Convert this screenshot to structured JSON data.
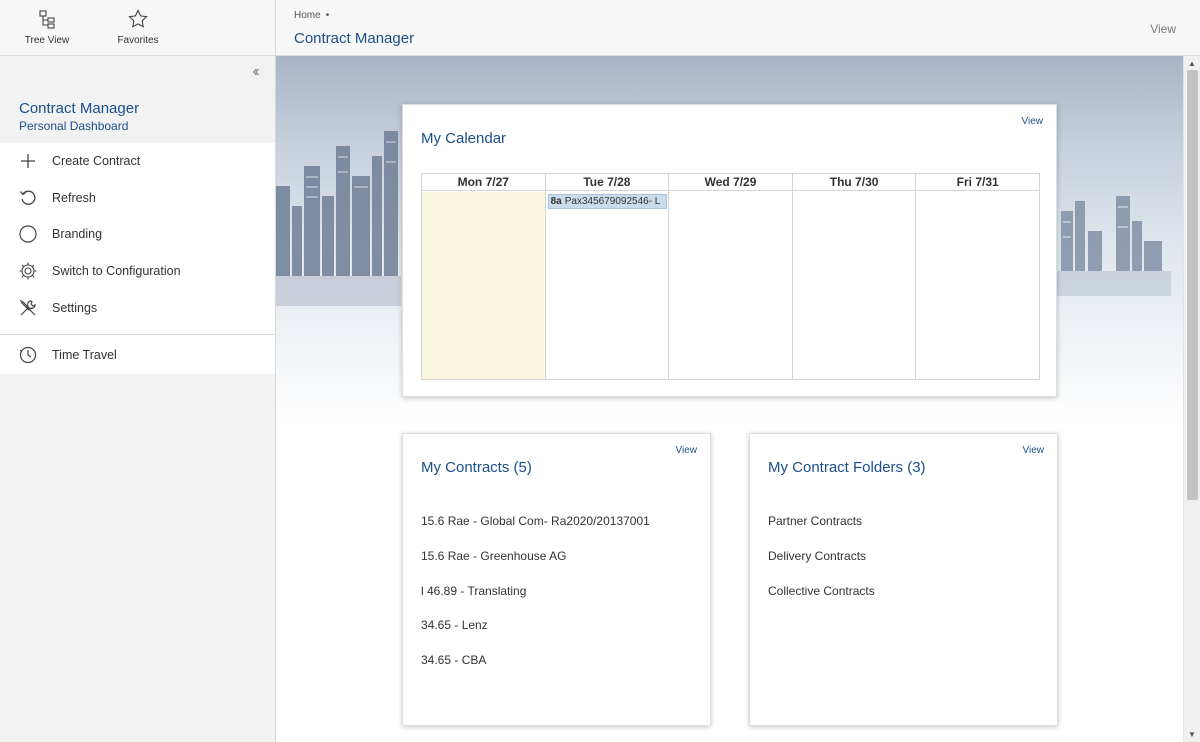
{
  "sidebar": {
    "tabs": [
      {
        "label": "Tree View",
        "icon": "tree-view-icon"
      },
      {
        "label": "Favorites",
        "icon": "star-icon"
      }
    ],
    "collapse_icon": "double-chevron-left-icon",
    "title": "Contract Manager",
    "subtitle": "Personal Dashboard",
    "menu": [
      {
        "label": "Create Contract",
        "icon": "plus-icon"
      },
      {
        "label": "Refresh",
        "icon": "refresh-icon"
      },
      {
        "label": "Branding",
        "icon": "circle-icon"
      },
      {
        "label": "Switch to Configuration",
        "icon": "gear-icon"
      },
      {
        "label": "Settings",
        "icon": "wrench-screwdriver-icon"
      },
      {
        "label": "Time Travel",
        "icon": "clock-icon"
      }
    ]
  },
  "header": {
    "breadcrumb": "Home",
    "breadcrumb_sep": "•",
    "title": "Contract Manager",
    "view_label": "View"
  },
  "calendar": {
    "title": "My Calendar",
    "view_label": "View",
    "days": [
      "Mon 7/27",
      "Tue 7/28",
      "Wed 7/29",
      "Thu 7/30",
      "Fri 7/31"
    ],
    "today_index": 0,
    "event": {
      "time": "8a",
      "text": "Pax345679092546- L",
      "day_index": 1
    }
  },
  "contracts": {
    "title": "My Contracts (5)",
    "view_label": "View",
    "items": [
      "15.6 Rae - Global Com- Ra2020/20137001",
      "15.6 Rae - Greenhouse AG",
      "l 46.89 - Translating",
      "34.65 - Lenz",
      "34.65 - CBA"
    ]
  },
  "folders": {
    "title": "My Contract Folders (3)",
    "view_label": "View",
    "items": [
      "Partner Contracts",
      "Delivery Contracts",
      "Collective Contracts"
    ]
  },
  "colors": {
    "accent": "#1b4f8a",
    "today_bg": "#fbf6df",
    "event_bg": "#c9dcec"
  }
}
